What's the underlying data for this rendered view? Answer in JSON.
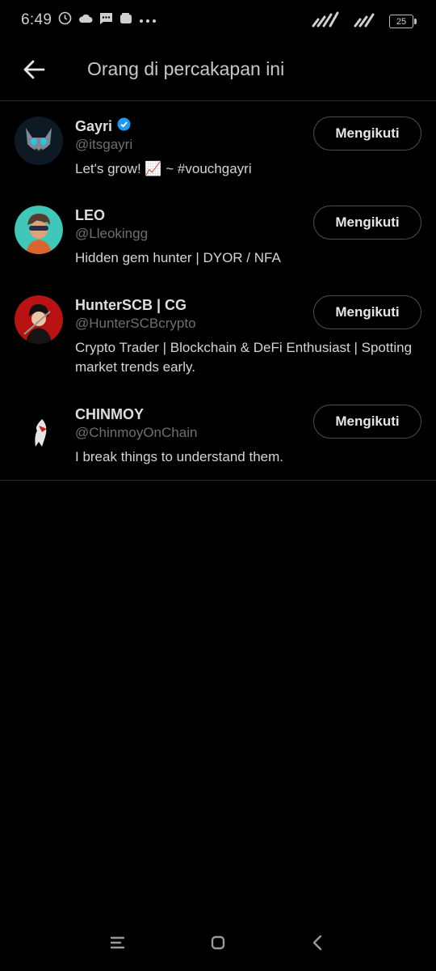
{
  "status_bar": {
    "time": "6:49",
    "battery_level": "25"
  },
  "header": {
    "title": "Orang di percakapan ini"
  },
  "people": [
    {
      "name": "Gayri",
      "verified": true,
      "handle": "@itsgayri",
      "bio": "Let's grow! 📈 ~ #vouchgayri",
      "button": "Mengikuti"
    },
    {
      "name": "LEO",
      "verified": false,
      "handle": "@Lleokingg",
      "bio": "Hidden gem hunter | DYOR / NFA",
      "button": "Mengikuti"
    },
    {
      "name": "HunterSCB | CG",
      "verified": false,
      "handle": "@HunterSCBcrypto",
      "bio": "Crypto Trader | Blockchain & DeFi Enthusiast | Spotting market trends early.",
      "button": "Mengikuti"
    },
    {
      "name": "CHINMOY",
      "verified": false,
      "handle": "@ChinmoyOnChain",
      "bio": "I break things to understand them.",
      "button": "Mengikuti"
    }
  ],
  "colors": {
    "background": "#000000",
    "verified": "#1d9bf0",
    "button_border": "#4a4f55"
  }
}
